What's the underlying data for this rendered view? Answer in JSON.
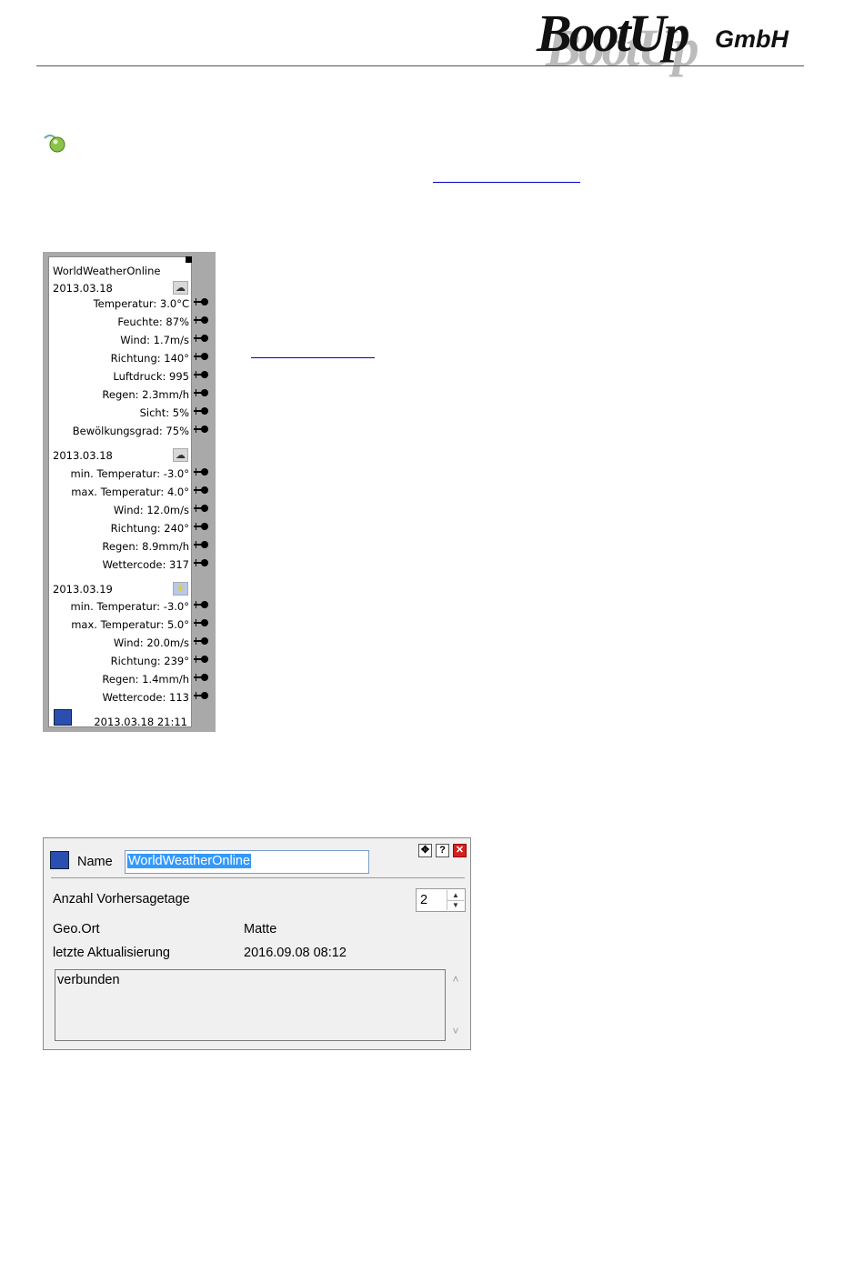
{
  "header": {
    "logo_main": "BootUp",
    "logo_suffix": "GmbH"
  },
  "block": {
    "title": "WorldWeatherOnline",
    "today": {
      "date": "2013.03.18",
      "icon": "cloud-icon",
      "rows": [
        "Temperatur: 3.0°C",
        "Feuchte: 87%",
        "Wind: 1.7m/s",
        "Richtung: 140°",
        "Luftdruck: 995",
        "Regen: 2.3mm/h",
        "Sicht: 5%",
        "Bewölkungsgrad: 75%"
      ]
    },
    "forecast1": {
      "date": "2013.03.18",
      "icon": "cloud-icon",
      "rows": [
        "min. Temperatur: -3.0°",
        "max. Temperatur: 4.0°",
        "Wind: 12.0m/s",
        "Richtung: 240°",
        "Regen: 8.9mm/h",
        "Wettercode: 317"
      ]
    },
    "forecast2": {
      "date": "2013.03.19",
      "icon": "sun-icon",
      "rows": [
        "min. Temperatur: -3.0°",
        "max. Temperatur: 5.0°",
        "Wind: 20.0m/s",
        "Richtung: 239°",
        "Regen: 1.4mm/h",
        "Wettercode: 113"
      ]
    },
    "footer_timestamp": "2013.03.18 21:11"
  },
  "dialog": {
    "name_label": "Name",
    "name_value": "WorldWeatherOnline",
    "toolbar": {
      "move": "move-icon",
      "help": "?",
      "close": "x"
    },
    "forecast_days_label": "Anzahl Vorhersagetage",
    "forecast_days_value": "2",
    "geo_label": "Geo.Ort",
    "geo_value": "Matte",
    "last_update_label": "letzte Aktualisierung",
    "last_update_value": "2016.09.08 08:12",
    "status_text": "verbunden"
  },
  "colors": {
    "link": "#0000cc",
    "selection": "#3399ff",
    "block_frame": "#a9a9a9",
    "close": "#d32020"
  }
}
